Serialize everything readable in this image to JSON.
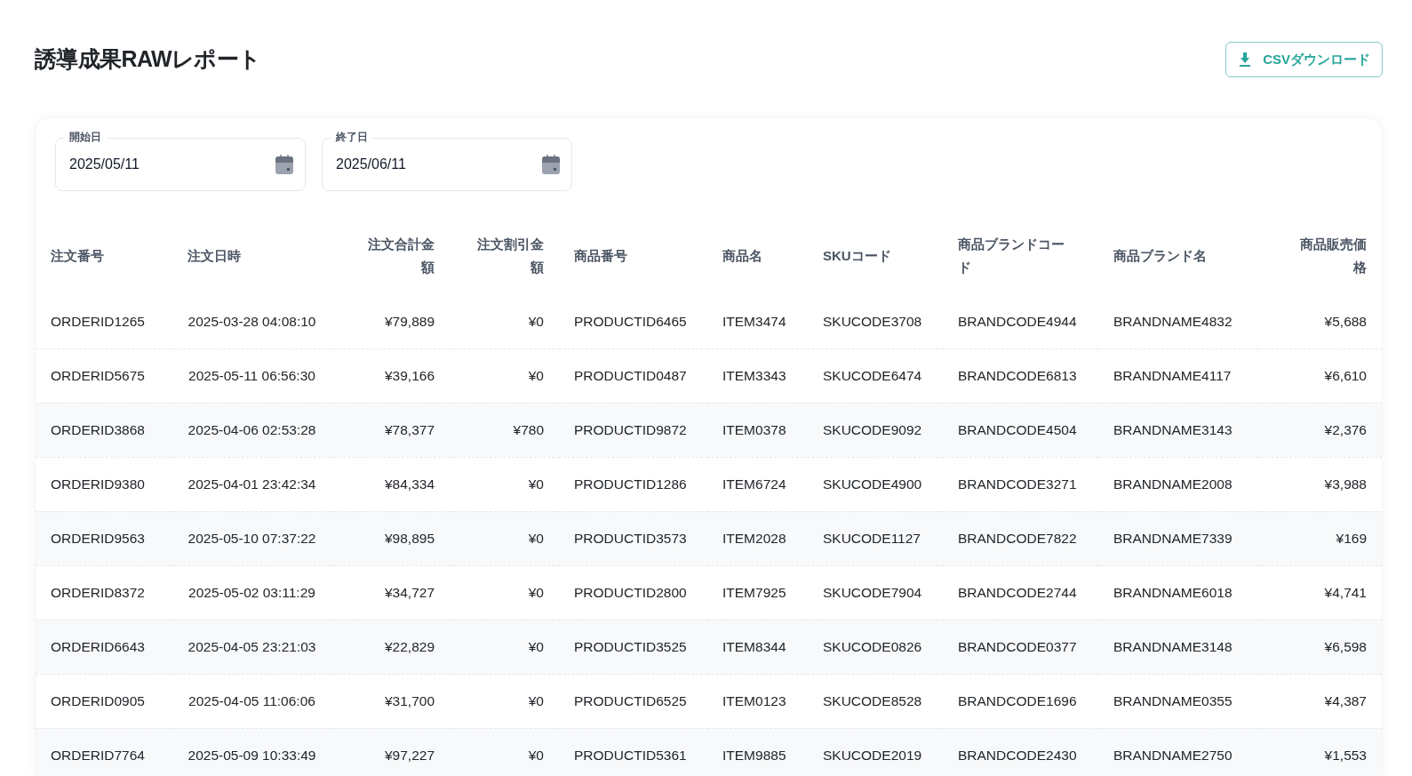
{
  "title": "誘導成果RAWレポート",
  "download_button": {
    "label": "CSVダウンロード"
  },
  "date_fields": [
    {
      "label": "開始日",
      "value": "2025/05/11"
    },
    {
      "label": "終了日",
      "value": "2025/06/11"
    }
  ],
  "table": {
    "columns": [
      {
        "label": "注文番号"
      },
      {
        "label": "注文日時"
      },
      {
        "label": "注文合計金額"
      },
      {
        "label": "注文割引金額"
      },
      {
        "label": "商品番号"
      },
      {
        "label": "商品名"
      },
      {
        "label": "SKUコード"
      },
      {
        "label": "商品ブランドコード"
      },
      {
        "label": "商品ブランド名"
      },
      {
        "label": "商品販売価格"
      }
    ],
    "rows": [
      [
        "ORDERID1265",
        "2025-03-28 04:08:10",
        "¥79,889",
        "¥0",
        "PRODUCTID6465",
        "ITEM3474",
        "SKUCODE3708",
        "BRANDCODE4944",
        "BRANDNAME4832",
        "¥5,688"
      ],
      [
        "ORDERID5675",
        "2025-05-11 06:56:30",
        "¥39,166",
        "¥0",
        "PRODUCTID0487",
        "ITEM3343",
        "SKUCODE6474",
        "BRANDCODE6813",
        "BRANDNAME4117",
        "¥6,610"
      ],
      [
        "ORDERID3868",
        "2025-04-06 02:53:28",
        "¥78,377",
        "¥780",
        "PRODUCTID9872",
        "ITEM0378",
        "SKUCODE9092",
        "BRANDCODE4504",
        "BRANDNAME3143",
        "¥2,376"
      ],
      [
        "ORDERID9380",
        "2025-04-01 23:42:34",
        "¥84,334",
        "¥0",
        "PRODUCTID1286",
        "ITEM6724",
        "SKUCODE4900",
        "BRANDCODE3271",
        "BRANDNAME2008",
        "¥3,988"
      ],
      [
        "ORDERID9563",
        "2025-05-10 07:37:22",
        "¥98,895",
        "¥0",
        "PRODUCTID3573",
        "ITEM2028",
        "SKUCODE1127",
        "BRANDCODE7822",
        "BRANDNAME7339",
        "¥169"
      ],
      [
        "ORDERID8372",
        "2025-05-02 03:11:29",
        "¥34,727",
        "¥0",
        "PRODUCTID2800",
        "ITEM7925",
        "SKUCODE7904",
        "BRANDCODE2744",
        "BRANDNAME6018",
        "¥4,741"
      ],
      [
        "ORDERID6643",
        "2025-04-05 23:21:03",
        "¥22,829",
        "¥0",
        "PRODUCTID3525",
        "ITEM8344",
        "SKUCODE0826",
        "BRANDCODE0377",
        "BRANDNAME3148",
        "¥6,598"
      ],
      [
        "ORDERID0905",
        "2025-04-05 11:06:06",
        "¥31,700",
        "¥0",
        "PRODUCTID6525",
        "ITEM0123",
        "SKUCODE8528",
        "BRANDCODE1696",
        "BRANDNAME0355",
        "¥4,387"
      ],
      [
        "ORDERID7764",
        "2025-05-09 10:33:49",
        "¥97,227",
        "¥0",
        "PRODUCTID5361",
        "ITEM9885",
        "SKUCODE2019",
        "BRANDCODE2430",
        "BRANDNAME2750",
        "¥1,553"
      ]
    ]
  }
}
